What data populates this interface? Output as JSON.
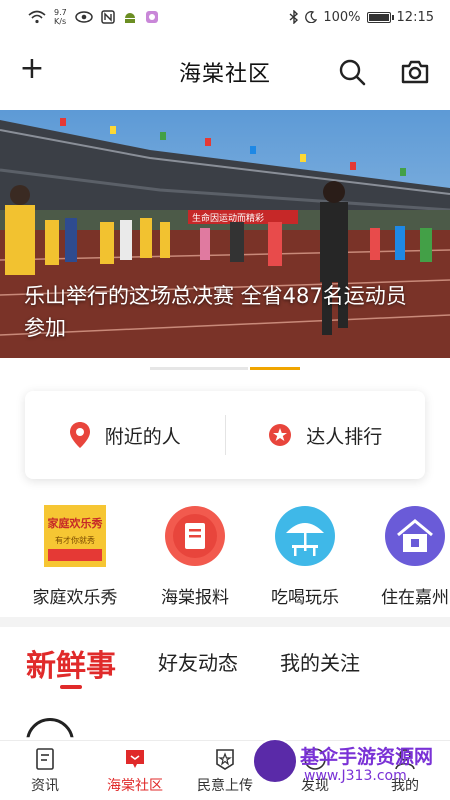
{
  "status_bar": {
    "speed_value": "9.7",
    "speed_unit": "K/s",
    "battery": "100%",
    "time": "12:15",
    "battery_level": 1.0
  },
  "header": {
    "title": "海棠社区",
    "left_icon": "plus-icon",
    "right_icons": [
      "search-icon",
      "camera-icon"
    ]
  },
  "banner": {
    "caption": "乐山举行的这场总决赛 全省487名运动员参加",
    "sign_text": "生命因运动而精彩"
  },
  "quick_links": [
    {
      "label": "附近的人",
      "icon": "location-pin-icon",
      "color": "#e8453c"
    },
    {
      "label": "达人排行",
      "icon": "star-badge-icon",
      "color": "#e8453c"
    }
  ],
  "categories": [
    {
      "label": "家庭欢乐秀",
      "icon": "family-show-icon",
      "image_title": "家庭欢乐秀",
      "image_subtitle": "有才你就秀"
    },
    {
      "label": "海棠报料",
      "icon": "report-icon"
    },
    {
      "label": "吃喝玩乐",
      "icon": "umbrella-table-icon"
    },
    {
      "label": "住在嘉州",
      "icon": "house-icon"
    }
  ],
  "feed_tabs": [
    {
      "label": "新鲜事",
      "active": true
    },
    {
      "label": "好友动态",
      "active": false
    },
    {
      "label": "我的关注",
      "active": false
    }
  ],
  "bottom_nav": [
    {
      "label": "资讯",
      "icon": "news-icon",
      "active": false
    },
    {
      "label": "海棠社区",
      "icon": "community-icon",
      "active": true
    },
    {
      "label": "民意上传",
      "icon": "upload-badge-icon",
      "active": false
    },
    {
      "label": "发现",
      "icon": "discover-icon",
      "active": false
    },
    {
      "label": "我的",
      "icon": "profile-icon",
      "active": false
    }
  ],
  "watermark": {
    "title": "基伞手游资源网",
    "url": "www.J313.com"
  },
  "colors": {
    "accent": "#e02a2a",
    "indicator_active": "#f0a500"
  }
}
